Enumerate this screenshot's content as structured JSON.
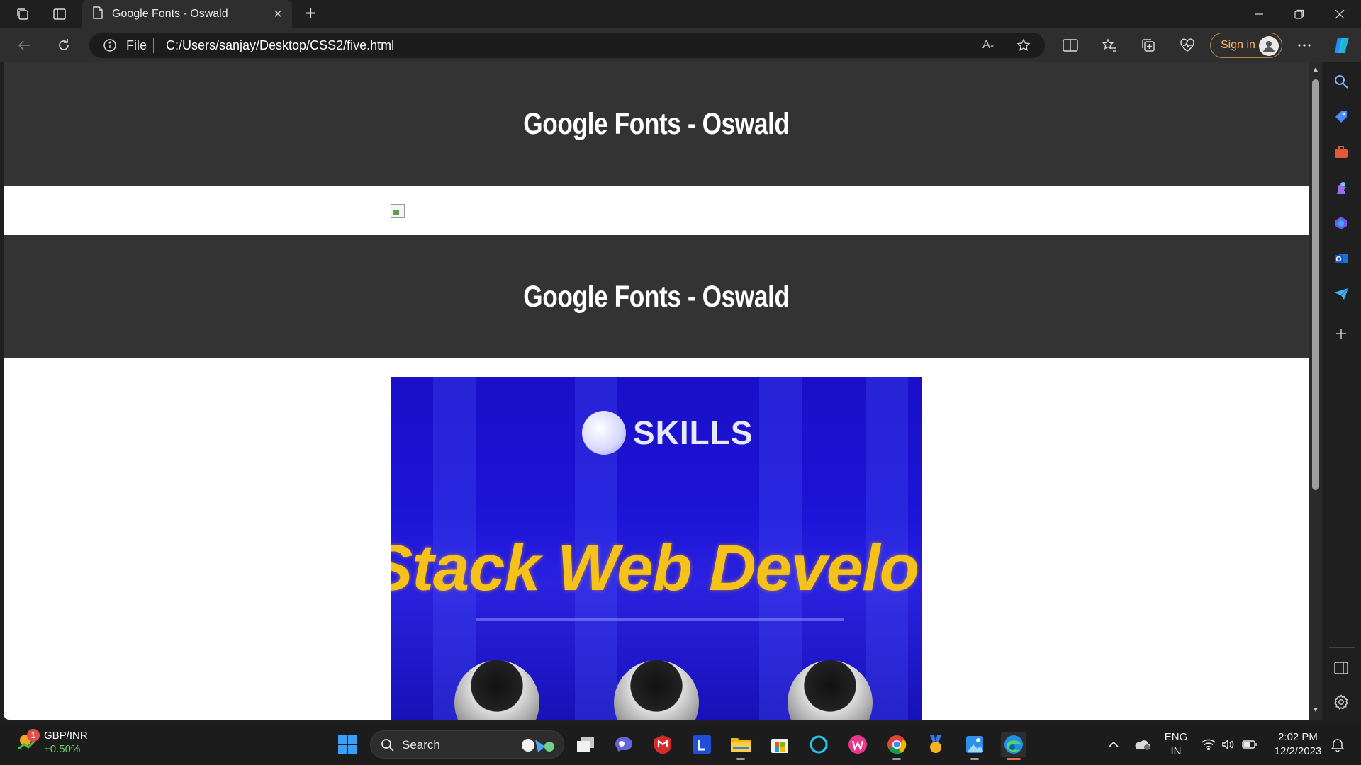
{
  "browser": {
    "tab_title": "Google Fonts - Oswald",
    "address_scheme": "File",
    "address_url": "C:/Users/sanjay/Desktop/CSS2/five.html",
    "sign_in_label": "Sign in",
    "accent": "#f2b56b"
  },
  "page": {
    "heading_1": "Google Fonts - Oswald",
    "heading_2": "Google Fonts - Oswald",
    "header_bg": "#333333",
    "banner": {
      "brand": "SKILLS",
      "headline": "Stack Web Develo"
    }
  },
  "taskbar": {
    "widget_badge": "1",
    "widget_title": "GBP/INR",
    "widget_change": "+0.50%",
    "search_label": "Search",
    "lang_top": "ENG",
    "lang_bottom": "IN",
    "time": "2:02 PM",
    "date": "12/2/2023"
  },
  "icons": {
    "browser": [
      "workspaces-icon",
      "tab-actions-icon",
      "page-icon",
      "close-icon",
      "plus-icon",
      "minimize-icon",
      "restore-icon",
      "window-close-icon",
      "back-icon",
      "refresh-icon",
      "info-icon",
      "read-aloud-icon",
      "favorite-star-icon",
      "split-screen-icon",
      "favorites-icon",
      "collections-icon",
      "browser-essentials-icon",
      "more-icon",
      "copilot-icon"
    ],
    "sidebar": [
      "search-icon",
      "shopping-tag-icon",
      "tools-icon",
      "games-icon",
      "microsoft-365-icon",
      "outlook-icon",
      "drop-icon",
      "add-icon",
      "hide-sidebar-icon",
      "settings-icon"
    ],
    "taskbar": [
      "windows-start-icon",
      "widgets-icon",
      "task-view-icon",
      "meet-icon",
      "mcafee-icon",
      "l-app-icon",
      "file-explorer-icon",
      "store-icon",
      "cortana-icon",
      "wps-icon",
      "chrome-icon",
      "medal-icon",
      "photos-icon",
      "edge-icon"
    ]
  }
}
